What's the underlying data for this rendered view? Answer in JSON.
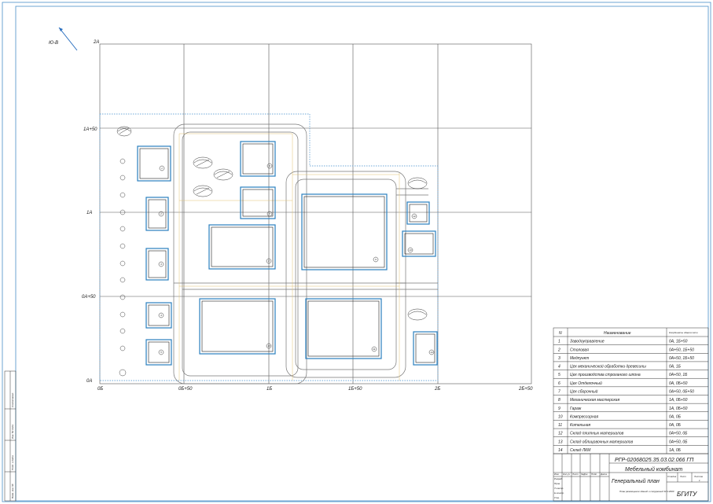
{
  "north_label": "Ю-В",
  "grid": {
    "top_label": "2А",
    "left_labels": [
      "1А+50",
      "1А",
      "0А+50",
      "0А"
    ],
    "bottom_labels": [
      "0Б",
      "0Б+50",
      "1Б",
      "1Б+50",
      "2Б",
      "2Б+50"
    ]
  },
  "building_numbers": [
    "1",
    "2",
    "3",
    "4",
    "5",
    "6",
    "7",
    "8",
    "9",
    "10",
    "11",
    "12",
    "13",
    "14"
  ],
  "legend": {
    "col_n": "N",
    "col_name": "Наименование",
    "col_coord": "Координаты здания сети",
    "rows": [
      {
        "n": "1",
        "name": "Заводоуправление",
        "coord": "0А, 1Б+50"
      },
      {
        "n": "2",
        "name": "Столовая",
        "coord": "0А+50, 1Б+50"
      },
      {
        "n": "3",
        "name": "Медпункт",
        "coord": "0А+50, 1Б+50"
      },
      {
        "n": "4",
        "name": "Цех механической обработки древесины",
        "coord": "0А, 1Б"
      },
      {
        "n": "5",
        "name": "Цех производства строганого шпона",
        "coord": "0А+50, 1Б"
      },
      {
        "n": "6",
        "name": "Цех Отделочный",
        "coord": "0А, 0Б+50"
      },
      {
        "n": "7",
        "name": "Цех сборочный",
        "coord": "0А+50, 0Б+50"
      },
      {
        "n": "8",
        "name": "Механическая мастерская",
        "coord": "1А, 0Б+50"
      },
      {
        "n": "9",
        "name": "Гараж",
        "coord": "1А, 0Б+50"
      },
      {
        "n": "10",
        "name": "Компрессорная",
        "coord": "0А, 0Б"
      },
      {
        "n": "11",
        "name": "Котельная",
        "coord": "0А, 0Б"
      },
      {
        "n": "12",
        "name": "Склад плитных материалов",
        "coord": "0А+50, 0Б"
      },
      {
        "n": "13",
        "name": "Склад облицовочных материалов",
        "coord": "0А+50, 0Б"
      },
      {
        "n": "14",
        "name": "Склад ЛКМ",
        "coord": "1А, 0Б"
      }
    ]
  },
  "stamp": {
    "code": "РГР-02068025.35.03.02.066 ГП",
    "project": "Мебельный комбинат",
    "sheet_title": "Генеральный план",
    "sheet_subtitle": "План размещения зданий и сооружений М 1:2000",
    "org": "БГИТУ",
    "col_stage": "Стадия",
    "col_sheet": "Лист",
    "col_sheets": "Листов",
    "sheets_value": "1",
    "h_izm": "Изм.",
    "h_koluch": "Кол.уч",
    "h_list": "Лист",
    "h_ndok": "№Док.",
    "h_podp": "Подп.",
    "h_data": "Дата",
    "razrab": "Разраб.",
    "prov": "Пров.",
    "nkontr": "Н.контр.",
    "tkontr": "Т.контр.",
    "utv": "Утв."
  },
  "side_stamp": [
    "Согласовано",
    "Инв. № подл.",
    "Подп. и дата",
    "Взам. инв. №"
  ]
}
